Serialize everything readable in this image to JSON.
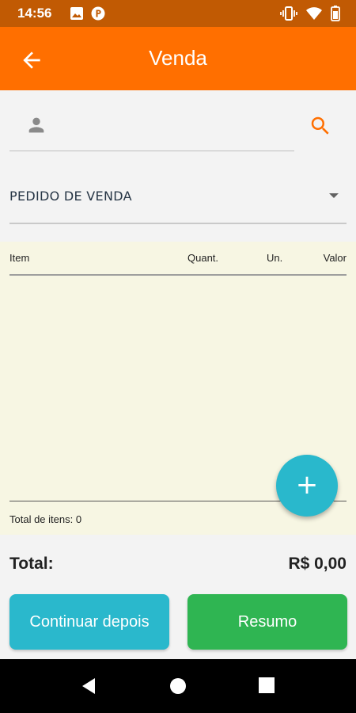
{
  "status_bar": {
    "time": "14:56"
  },
  "app_bar": {
    "title": "Venda"
  },
  "search": {
    "value": "",
    "placeholder": ""
  },
  "order_type": {
    "selected": "PEDIDO DE VENDA"
  },
  "table": {
    "columns": [
      "Item",
      "Quant.",
      "Un.",
      "Valor"
    ],
    "rows": [],
    "total_items_label": "Total de itens: 0"
  },
  "fab": {
    "label": "+"
  },
  "summary": {
    "total_label": "Total:",
    "total_value": "R$ 0,00"
  },
  "buttons": {
    "continue_later": "Continuar depois",
    "summary": "Resumo"
  },
  "colors": {
    "accent": "#ff6f00",
    "status_bar": "#c15a03",
    "teal": "#2ab8cc",
    "green": "#2fb552",
    "panel": "#f7f6e3"
  },
  "icons": [
    "image-icon",
    "parking-icon",
    "vibrate-icon",
    "wifi-icon",
    "battery-icon",
    "arrow-back-icon",
    "person-icon",
    "search-icon",
    "chevron-down-icon",
    "back-triangle-icon",
    "home-circle-icon",
    "recents-square-icon"
  ]
}
